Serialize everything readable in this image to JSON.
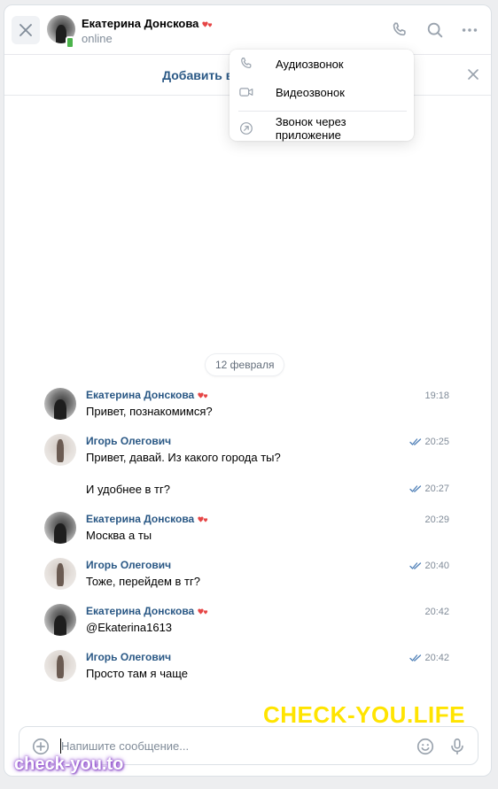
{
  "header": {
    "name": "Екатерина Донскова",
    "status": "online"
  },
  "subbar": {
    "add_friend": "Добавить в друзья"
  },
  "call_menu": {
    "audio": "Аудиозвонок",
    "video": "Видеозвонок",
    "app_call": "Звонок через приложение"
  },
  "chat": {
    "date": "12 февраля",
    "messages": [
      {
        "author": "Екатерина Донскова",
        "heart": true,
        "text": "Привет, познакомимся?",
        "time": "19:18",
        "read": false
      },
      {
        "author": "Игорь Олегович",
        "heart": false,
        "text": "Привет, давай. Из какого города ты?",
        "time": "20:25",
        "read": true
      },
      {
        "author": "",
        "heart": false,
        "text": "И удобнее в тг?",
        "time": "20:27",
        "read": true
      },
      {
        "author": "Екатерина Донскова",
        "heart": true,
        "text": "Москва а ты",
        "time": "20:29",
        "read": false
      },
      {
        "author": "Игорь Олегович",
        "heart": false,
        "text": "Тоже, перейдем в тг?",
        "time": "20:40",
        "read": true
      },
      {
        "author": "Екатерина Донскова",
        "heart": true,
        "text": "@Ekaterina1613",
        "time": "20:42",
        "read": false
      },
      {
        "author": "Игорь Олегович",
        "heart": false,
        "text": "Просто там я чаще",
        "time": "20:42",
        "read": true
      }
    ]
  },
  "composer": {
    "placeholder": "Напишите сообщение..."
  },
  "watermarks": {
    "yellow": "CHECK-YOU.LIFE",
    "pink": "check-you.to"
  },
  "colors": {
    "link": "#2a5885",
    "online": "#4bb34b",
    "heart": "#e64646",
    "tick": "#5181b8",
    "icon": "#99a2ad"
  }
}
